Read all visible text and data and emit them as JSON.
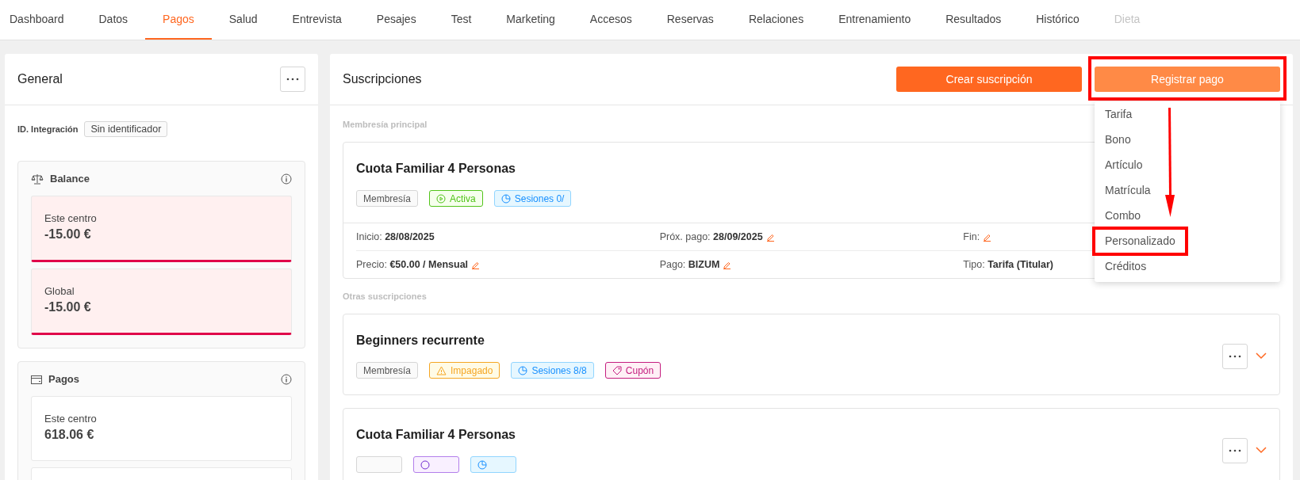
{
  "tabs": [
    {
      "label": "Dashboard",
      "selected": false,
      "disabled": false
    },
    {
      "label": "Datos",
      "selected": false,
      "disabled": false
    },
    {
      "label": "Pagos",
      "selected": true,
      "disabled": false
    },
    {
      "label": "Salud",
      "selected": false,
      "disabled": false
    },
    {
      "label": "Entrevista",
      "selected": false,
      "disabled": false
    },
    {
      "label": "Pesajes",
      "selected": false,
      "disabled": false
    },
    {
      "label": "Test",
      "selected": false,
      "disabled": false
    },
    {
      "label": "Marketing",
      "selected": false,
      "disabled": false
    },
    {
      "label": "Accesos",
      "selected": false,
      "disabled": false
    },
    {
      "label": "Reservas",
      "selected": false,
      "disabled": false
    },
    {
      "label": "Relaciones",
      "selected": false,
      "disabled": false
    },
    {
      "label": "Entrenamiento",
      "selected": false,
      "disabled": false
    },
    {
      "label": "Resultados",
      "selected": false,
      "disabled": false
    },
    {
      "label": "Histórico",
      "selected": false,
      "disabled": false
    },
    {
      "label": "Dieta",
      "selected": false,
      "disabled": true
    }
  ],
  "general": {
    "title": "General",
    "integration_label": "ID. Integración",
    "integration_value": "Sin identificador",
    "sections": [
      {
        "kind": "balance",
        "title": "Balance",
        "stats": [
          {
            "label": "Este centro",
            "value": "-15.00 €",
            "negative": true
          },
          {
            "label": "Global",
            "value": "-15.00 €",
            "negative": true
          }
        ]
      },
      {
        "kind": "payments",
        "title": "Pagos",
        "stats": [
          {
            "label": "Este centro",
            "value": "618.06 €",
            "negative": false
          },
          {
            "negative": false
          }
        ]
      }
    ]
  },
  "subscriptions": {
    "title": "Suscripciones",
    "buttons": [
      {
        "label": "Crear suscripción",
        "kind": "primary",
        "highlighted": false
      },
      {
        "label": "Registrar pago",
        "kind": "secondary",
        "highlighted": true
      }
    ],
    "menu": [
      {
        "label": "Tarifa",
        "highlighted": false
      },
      {
        "label": "Bono",
        "highlighted": false
      },
      {
        "label": "Artículo",
        "highlighted": false
      },
      {
        "label": "Matrícula",
        "highlighted": false
      },
      {
        "label": "Combo",
        "highlighted": false
      },
      {
        "label": "Personalizado",
        "highlighted": true
      },
      {
        "label": "Créditos",
        "highlighted": false
      }
    ],
    "main_heading": "Membresía principal",
    "main": {
      "title": "Cuota Familiar 4 Personas",
      "tags": [
        {
          "kind": "neutral",
          "label": "Membresía"
        },
        {
          "kind": "success",
          "label": "Activa"
        },
        {
          "kind": "info",
          "label": "Sesiones 0/"
        }
      ],
      "details": [
        [
          {
            "label": "Inicio:",
            "value": "28/08/2025",
            "editable": false
          },
          {
            "label": "Próx. pago:",
            "value": "28/09/2025",
            "editable": true
          },
          {
            "label": "Fin:",
            "editable": true
          }
        ],
        [
          {
            "label": "Precio:",
            "value": "€50.00 / Mensual",
            "editable": true
          },
          {
            "label": "Pago:",
            "value": "BIZUM",
            "editable": true
          },
          {
            "label": "Tipo:",
            "value": "Tarifa (Titular)",
            "editable": false
          }
        ]
      ]
    },
    "others_heading": "Otras suscripciones",
    "others": [
      {
        "title": "Beginners recurrente",
        "tags": [
          {
            "kind": "neutral",
            "label": "Membresía"
          },
          {
            "kind": "warning",
            "label": "Impagado"
          },
          {
            "kind": "info",
            "label": "Sesiones 8/8"
          },
          {
            "kind": "danger",
            "label": "Cupón"
          }
        ]
      },
      {
        "title": "Cuota Familiar 4 Personas",
        "tags": [
          {
            "kind": "neutral"
          },
          {
            "kind": "violet"
          },
          {
            "kind": "info"
          }
        ]
      }
    ]
  }
}
